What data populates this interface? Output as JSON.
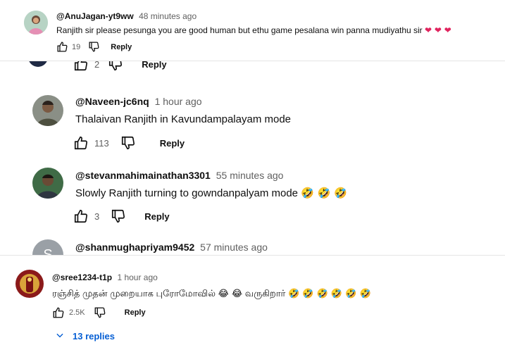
{
  "comments": [
    {
      "handle": "@AnuJagan-yt9ww",
      "time": "48 minutes ago",
      "text": "Ranjith sir please pesunga you are good human but ethu game pesalana win panna mudiyathu sir",
      "emoji": "❤ ❤ ❤",
      "likes": "19",
      "reply_label": "Reply"
    },
    {
      "partial_likes": "2",
      "reply_label": "Reply"
    },
    {
      "handle": "@Naveen-jc6nq",
      "time": "1 hour ago",
      "text": "Thalaivan Ranjith in  Kavundampalayam mode",
      "likes": "113",
      "reply_label": "Reply"
    },
    {
      "handle": "@stevanmahimainathan3301",
      "time": "55 minutes ago",
      "text": "Slowly Ranjith turning to gowndanpalyam mode",
      "emoji": "🤣 🤣 🤣",
      "likes": "3",
      "reply_label": "Reply"
    },
    {
      "handle": "@shanmughapriyam9452",
      "time": "57 minutes ago",
      "avatar_letter": "S"
    },
    {
      "handle": "@sree1234-t1p",
      "time": "1 hour ago",
      "text": "ரஞ்சித் முதன் முறையாக புரோமோவில்",
      "emoji_mid": "😂 😂",
      "text_2": "வருகிறார்",
      "emoji": "🤣 🤣 🤣 🤣 🤣 🤣",
      "likes": "2.5K",
      "reply_label": "Reply",
      "replies_label": "13 replies"
    }
  ],
  "colors": {
    "link": "#065fd4",
    "secondary": "#606060",
    "heart": "#e0245e"
  }
}
